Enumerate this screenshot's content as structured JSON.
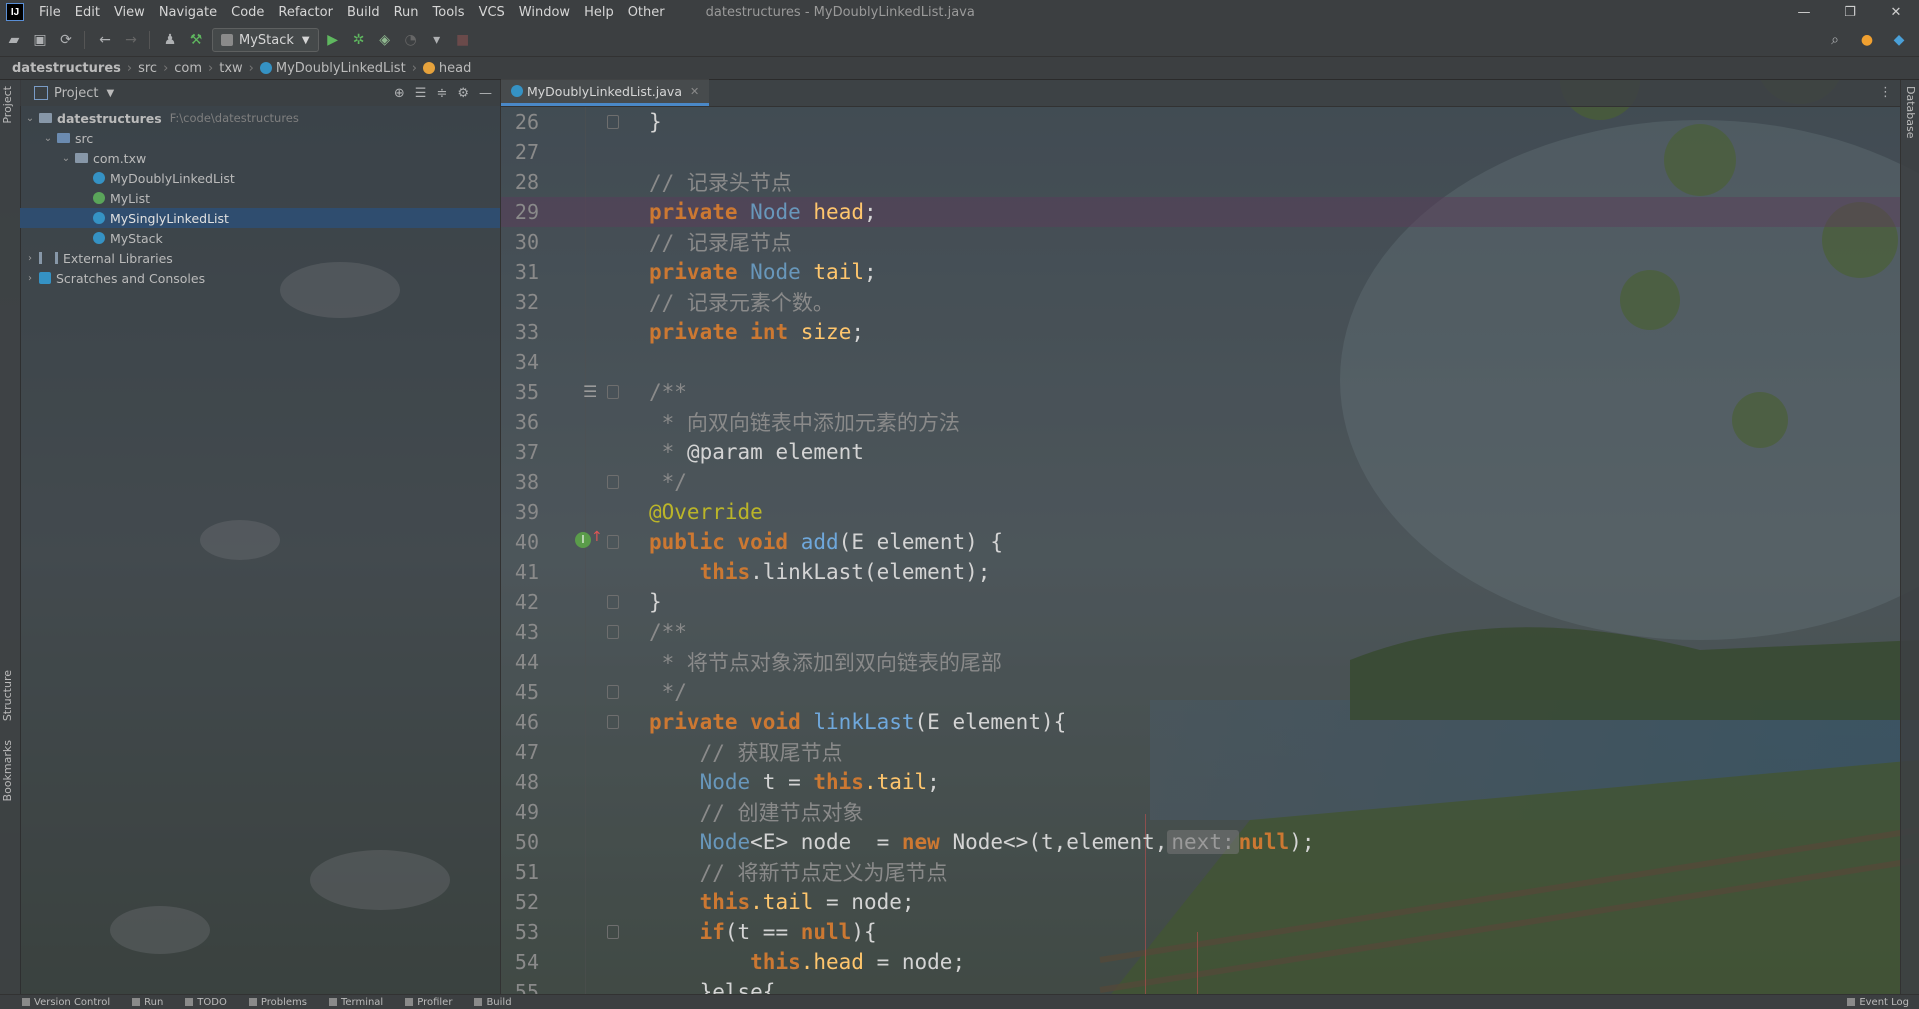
{
  "menubar": {
    "logo": "IJ",
    "items": [
      "File",
      "Edit",
      "View",
      "Navigate",
      "Code",
      "Refactor",
      "Build",
      "Run",
      "Tools",
      "VCS",
      "Window",
      "Help",
      "Other"
    ],
    "window_title": "datestructures - MyDoublyLinkedList.java"
  },
  "toolbar": {
    "run_config": "MyStack"
  },
  "breadcrumb": [
    "datestructures",
    "src",
    "com",
    "txw",
    "MyDoublyLinkedList",
    "head"
  ],
  "left_strip": {
    "project_tab": "Project",
    "structure_tab": "Structure",
    "bookmarks_tab": "Bookmarks"
  },
  "right_strip": {
    "database_tab": "Database"
  },
  "project_panel": {
    "title": "Project",
    "root": {
      "name": "datestructures",
      "path": "F:\\code\\datestructures"
    },
    "src": "src",
    "package": "com.txw",
    "files": [
      "MyDoublyLinkedList",
      "MyList",
      "MySinglyLinkedList",
      "MyStack"
    ],
    "external_libraries": "External Libraries",
    "scratches": "Scratches and Consoles"
  },
  "editor": {
    "tab": "MyDoublyLinkedList.java",
    "line_numbers": [
      "26",
      "27",
      "28",
      "29",
      "30",
      "31",
      "32",
      "33",
      "34",
      "35",
      "36",
      "37",
      "38",
      "39",
      "40",
      "41",
      "42",
      "43",
      "44",
      "45",
      "46",
      "47",
      "48",
      "49",
      "50",
      "51",
      "52",
      "53",
      "54",
      "55"
    ],
    "tokens": {
      "t26": "}",
      "t28": "// 记录头节点",
      "kw_private": "private",
      "t29_type": "Node",
      "t29_field": "head",
      "t29_semi": ";",
      "t30": "// 记录尾节点",
      "t31_field": "tail",
      "t32": "// 记录元素个数。",
      "t33_type": "int",
      "t33_field": "size",
      "t35": "/**",
      "t36": " * 向双向链表中添加元素的方法",
      "t37_star": " * ",
      "t37_param": "@param",
      "t37_rest": " element",
      "t38": " */",
      "t39": "@Override",
      "t40_kw": "public void",
      "t40_fn": "add",
      "t40_rest": "(E element) {",
      "t41_this": "this",
      "t41_rest": ".linkLast(element);",
      "t42": "}",
      "t43": "/**",
      "t44": " * 将节点对象添加到双向链表的尾部",
      "t45": " */",
      "t46_kw": "private void",
      "t46_fn": "linkLast",
      "t46_rest": "(E element){",
      "t47": "// 获取尾节点",
      "t48_type": "Node",
      "t48_mid": " t = ",
      "t48_this": "this",
      "t48_field": ".tail",
      "t48_end": ";",
      "t49": "// 创建节点对象",
      "t50_type": "Node",
      "t50_mid": "<E> node  = ",
      "t50_new": "new",
      "t50_call": " Node<>(t,element,",
      "t50_hint": "next:",
      "t50_null": "null",
      "t50_end": ");",
      "t51": "// 将新节点定义为尾节点",
      "t52_this": "this",
      "t52_field": ".tail",
      "t52_rest": " = node;",
      "t53_if": "if",
      "t53_rest": "(t == ",
      "t53_null": "null",
      "t53_end": "){",
      "t54_this": "this",
      "t54_field": ".head",
      "t54_rest": " = node;",
      "t55": "}else{"
    }
  },
  "statusbar": {
    "items": [
      "Version Control",
      "Run",
      "TODO",
      "Problems",
      "Terminal",
      "Profiler",
      "Build"
    ],
    "right": "Event Log"
  },
  "colors": {
    "keyword": "#cc7832",
    "type": "#6897bb",
    "field": "#ffc66d",
    "comment": "#8a8a8a",
    "annotation": "#bbb529",
    "selection": "#2f4d6f",
    "tab_underline": "#4a88c7"
  }
}
